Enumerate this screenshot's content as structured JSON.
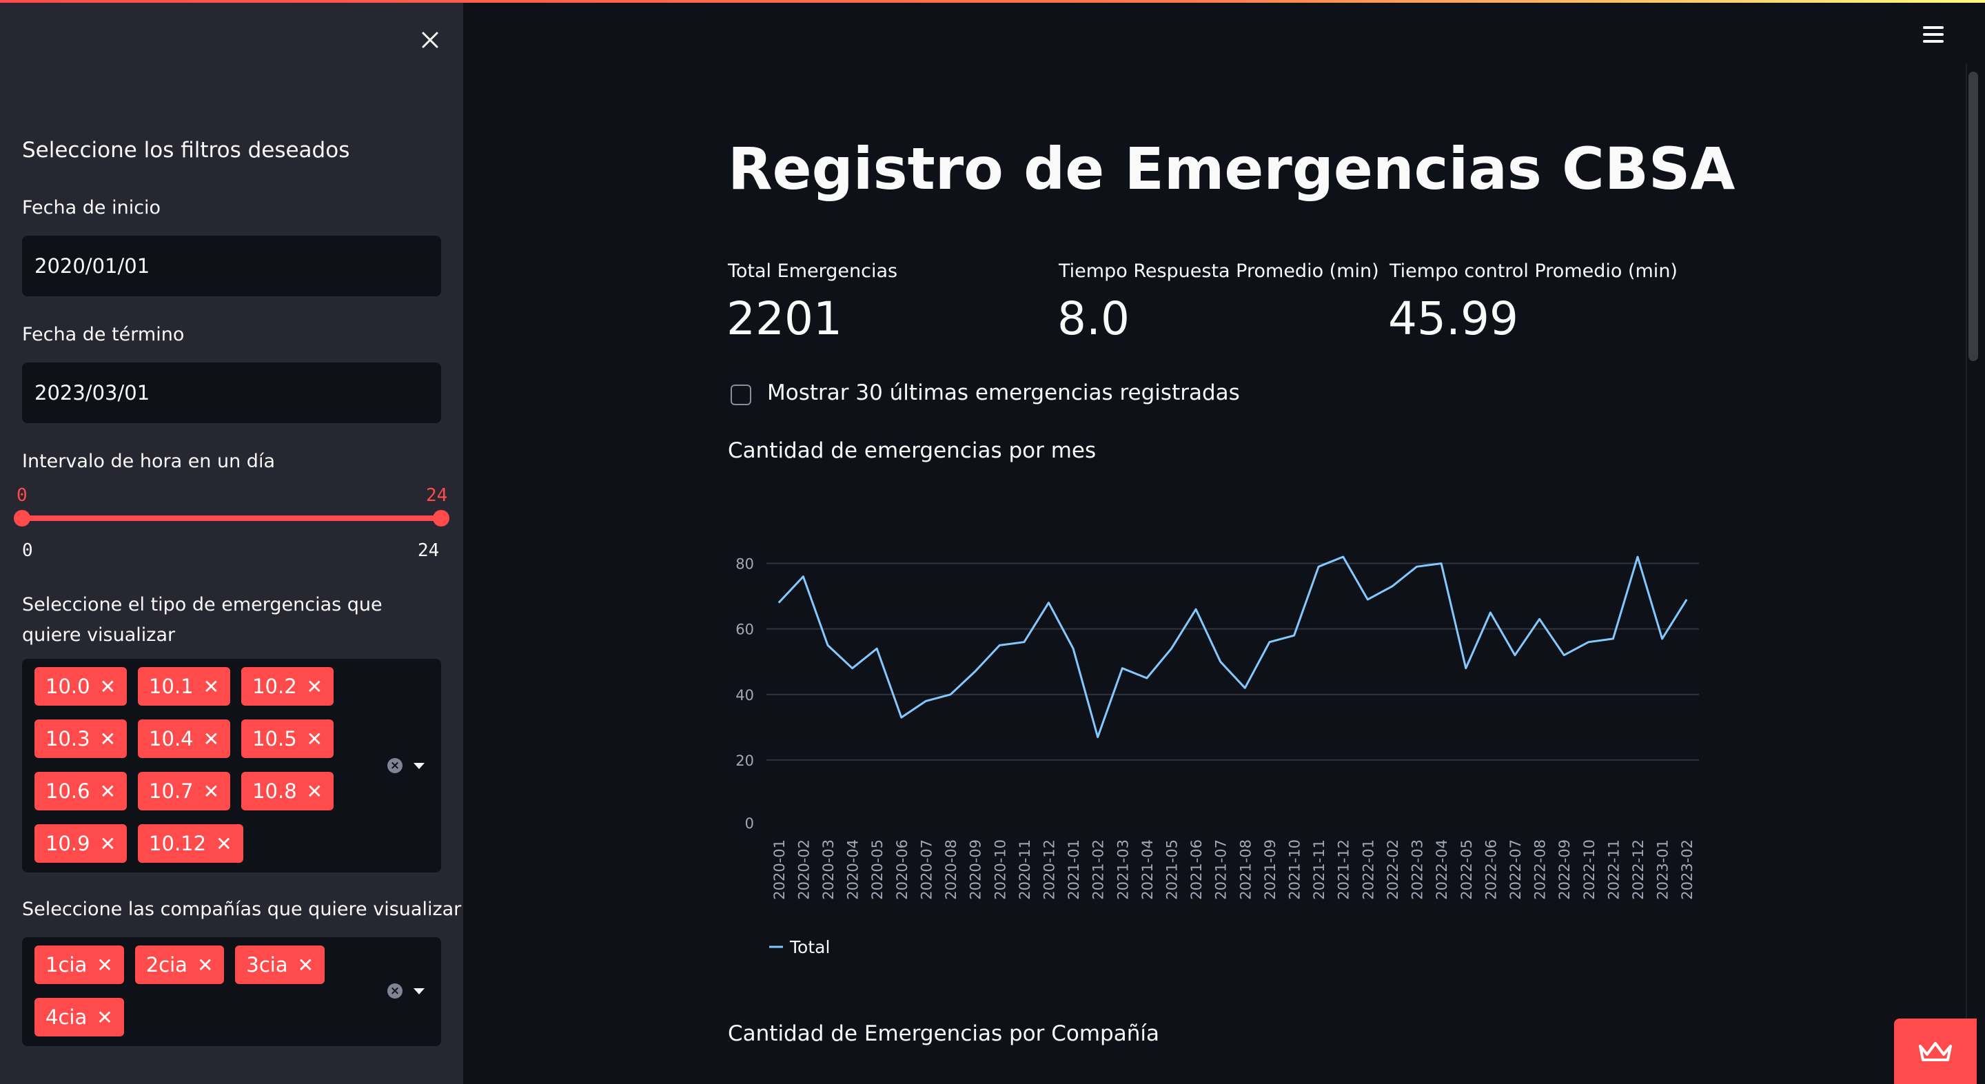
{
  "sidebar": {
    "heading": "Seleccione los filtros deseados",
    "start_date": {
      "label": "Fecha de inicio",
      "value": "2020/01/01"
    },
    "end_date": {
      "label": "Fecha de término",
      "value": "2023/03/01"
    },
    "hour_range": {
      "label": "Intervalo de hora en un día",
      "low": "0",
      "high": "24",
      "min": "0",
      "max": "24"
    },
    "emergency_types": {
      "label": "Seleccione el tipo de emergencias que quiere visualizar",
      "selected": [
        "10.0",
        "10.1",
        "10.2",
        "10.3",
        "10.4",
        "10.5",
        "10.6",
        "10.7",
        "10.8",
        "10.9",
        "10.12"
      ]
    },
    "companies": {
      "label": "Seleccione las compañías que quiere visualizar",
      "selected": [
        "1cia",
        "2cia",
        "3cia",
        "4cia"
      ]
    }
  },
  "main": {
    "title": "Registro de Emergencias CBSA",
    "metrics": [
      {
        "label": "Total Emergencias",
        "value": "2201"
      },
      {
        "label": "Tiempo Respuesta Promedio (min)",
        "value": "8.0"
      },
      {
        "label": "Tiempo control Promedio (min)",
        "value": "45.99"
      }
    ],
    "checkbox_label": "Mostrar 30 últimas emergencias registradas",
    "chart_title": "Cantidad de emergencias por mes",
    "next_section_title": "Cantidad de Emergencias por Compañía"
  },
  "colors": {
    "accent": "#ff4b4b",
    "line": "#83c9ff",
    "sidebar_bg": "#262730",
    "main_bg": "#0e1117"
  },
  "icons": {
    "close": "close-icon",
    "menu": "hamburger-menu-icon",
    "badge": "crown-icon"
  },
  "chart_data": {
    "type": "line",
    "title": "",
    "xlabel": "",
    "ylabel": "",
    "x": [
      "2020-01",
      "2020-02",
      "2020-03",
      "2020-04",
      "2020-05",
      "2020-06",
      "2020-07",
      "2020-08",
      "2020-09",
      "2020-10",
      "2020-11",
      "2020-12",
      "2021-01",
      "2021-02",
      "2021-03",
      "2021-04",
      "2021-05",
      "2021-06",
      "2021-07",
      "2021-08",
      "2021-09",
      "2021-10",
      "2021-11",
      "2021-12",
      "2022-01",
      "2022-02",
      "2022-03",
      "2022-04",
      "2022-05",
      "2022-06",
      "2022-07",
      "2022-08",
      "2022-09",
      "2022-10",
      "2022-11",
      "2022-12",
      "2023-01",
      "2023-02"
    ],
    "series": [
      {
        "name": "Total",
        "values": [
          68,
          76,
          55,
          48,
          54,
          33,
          38,
          40,
          47,
          55,
          56,
          68,
          54,
          27,
          48,
          45,
          54,
          66,
          50,
          42,
          56,
          58,
          79,
          82,
          69,
          73,
          79,
          80,
          48,
          65,
          52,
          63,
          52,
          56,
          57,
          82,
          57,
          69
        ]
      }
    ],
    "yticks": [
      0,
      20,
      40,
      60,
      80
    ],
    "ylim": [
      0,
      90
    ],
    "grid": true,
    "legend": "bottom-left"
  }
}
